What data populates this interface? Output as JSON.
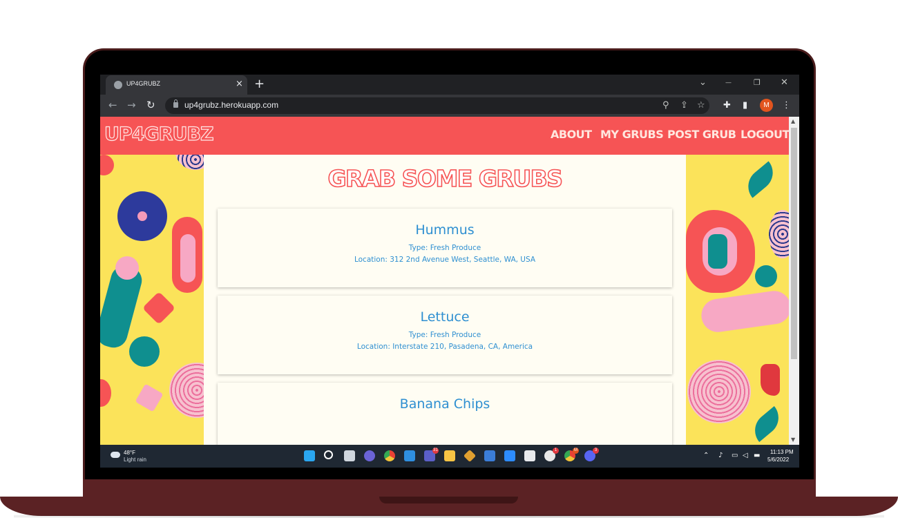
{
  "browser": {
    "tab_title": "UP4GRUBZ",
    "tab_close": "×",
    "new_tab": "+",
    "url": "up4grubz.herokuapp.com",
    "profile_initial": "M",
    "icons": {
      "back": "←",
      "forward": "→",
      "reload": "↻",
      "location": "⚲",
      "share": "⇪",
      "bookmark": "☆",
      "extensions": "✚",
      "sidebar": "▮",
      "menu": "⋮",
      "tab_search": "⌄",
      "minimize": "—",
      "restore": "❐",
      "close": "✕"
    }
  },
  "site": {
    "brand": "UP4GRUBZ",
    "nav": {
      "about": "About",
      "my_grubs": "My Grubs",
      "post_grub": "Post Grub",
      "logout": "Logout"
    },
    "heading": "Grab Some Grubs",
    "grubs": [
      {
        "name": "Hummus",
        "type": "Type: Fresh Produce",
        "location": "Location: 312 2nd Avenue West, Seattle, WA, USA"
      },
      {
        "name": "Lettuce",
        "type": "Type: Fresh Produce",
        "location": "Location: Interstate 210, Pasadena, CA, America"
      },
      {
        "name": "Banana Chips",
        "type": "",
        "location": ""
      }
    ]
  },
  "taskbar": {
    "weather_temp": "48°F",
    "weather_desc": "Light rain",
    "badges": {
      "teams": "31",
      "slack": "1",
      "chrome": "M",
      "discord": "3"
    },
    "time": "11:13 PM",
    "date": "5/6/2022",
    "colors": {
      "start": "#2aa6f0",
      "search": "#ffffff",
      "taskview": "#cfd6de",
      "chat": "#6b63d6",
      "chrome": "#f2c338",
      "vscode": "#2f8fe0",
      "teams": "#5b5fc7",
      "explorer": "#f7c444",
      "git": "#e0a030",
      "terminal": "#3b7dd8",
      "zoom": "#2d8cff",
      "store": "#e8eaed",
      "slack": "#e8e8e8",
      "chrome2": "#e94235",
      "discord": "#5865f2"
    }
  },
  "colors": {
    "navbar": "#f65455",
    "background": "#fbe35a",
    "card": "#fffdf3",
    "link_text": "#2e8fd1",
    "laptop": "#5b2224"
  }
}
